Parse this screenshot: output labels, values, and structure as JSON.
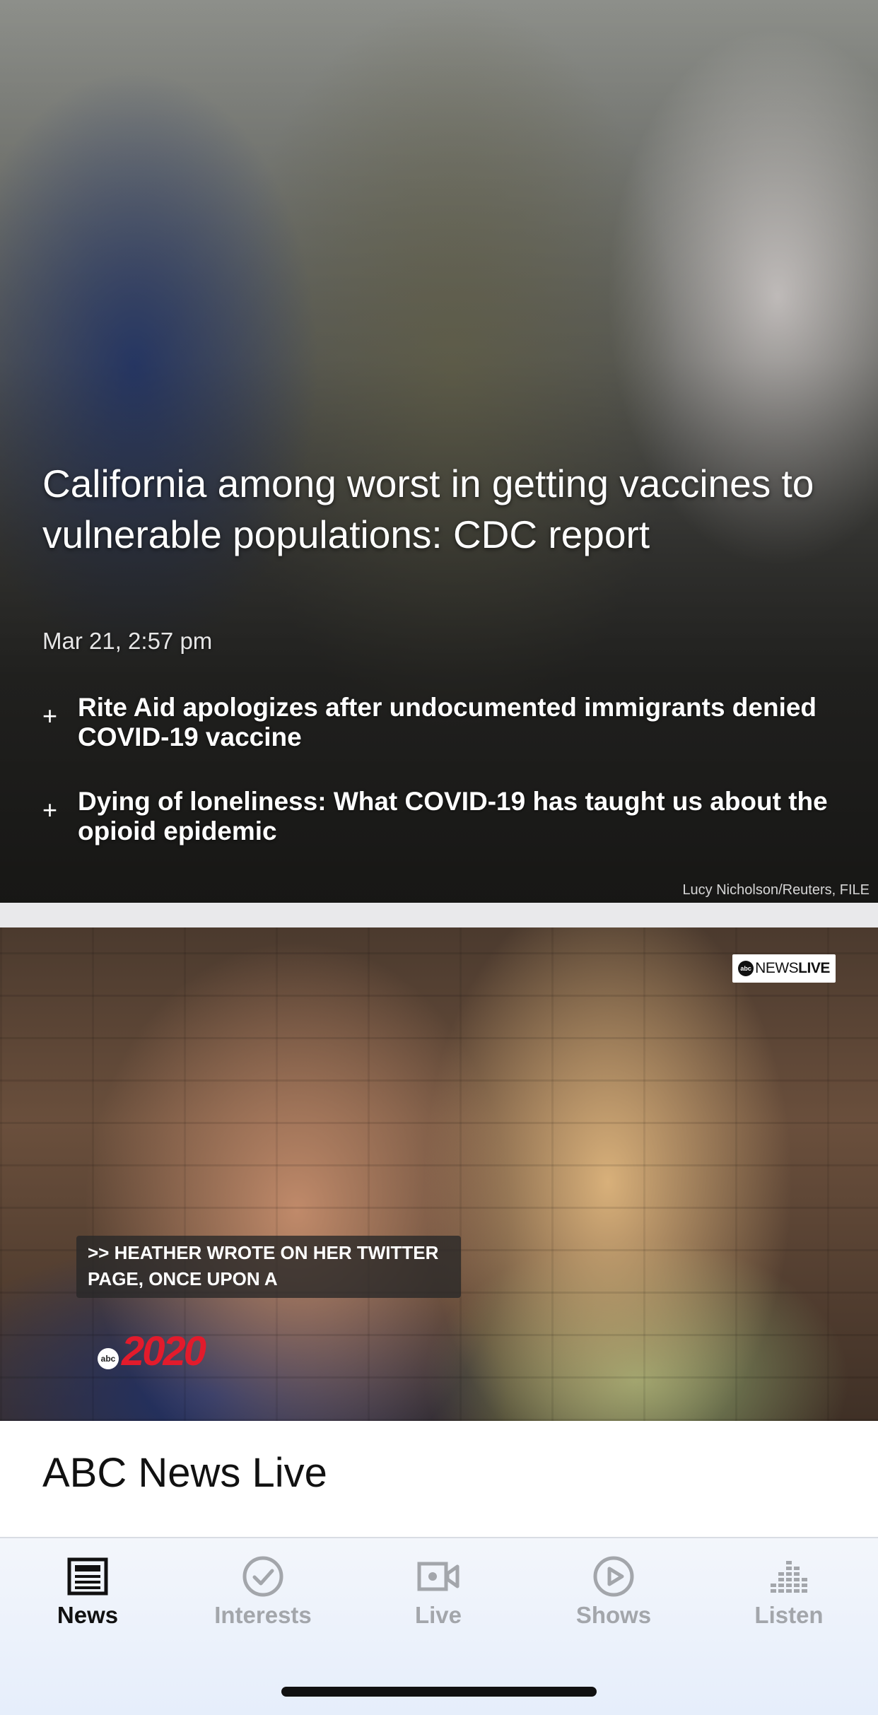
{
  "hero": {
    "headline": "California among worst in getting vaccines to vulnerable populations: CDC report",
    "date": "Mar 21, 2:57 pm",
    "related": [
      {
        "text": "Rite Aid apologizes after undocumented immigrants denied COVID-19 vaccine"
      },
      {
        "text": "Dying of loneliness: What COVID-19 has taught us about the opioid epidemic"
      }
    ],
    "photo_credit": "Lucy Nicholson/Reuters, FILE"
  },
  "video": {
    "badge_news": "NEWS",
    "badge_live": "LIVE",
    "badge_abc": "abc",
    "caption": ">> HEATHER WROTE ON HER TWITTER\nPAGE, ONCE UPON A",
    "show_logo_abc": "abc",
    "show_logo_num": "2020",
    "title": "ABC News Live"
  },
  "tabs": [
    {
      "label": "News",
      "icon": "newspaper-icon",
      "active": true
    },
    {
      "label": "Interests",
      "icon": "checkmark-circle-icon",
      "active": false
    },
    {
      "label": "Live",
      "icon": "video-camera-icon",
      "active": false
    },
    {
      "label": "Shows",
      "icon": "play-circle-icon",
      "active": false
    },
    {
      "label": "Listen",
      "icon": "equalizer-icon",
      "active": false
    }
  ],
  "colors": {
    "accent_red": "#e21b2c",
    "tab_active": "#111111",
    "tab_inactive": "#a3a6ab"
  }
}
